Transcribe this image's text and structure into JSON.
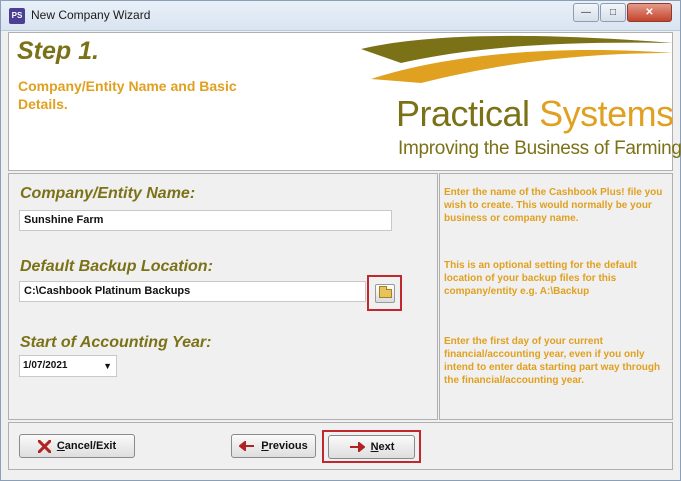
{
  "window": {
    "app_icon": "PS",
    "title": "New Company Wizard",
    "controls": [
      "minimize",
      "maximize",
      "close"
    ]
  },
  "header": {
    "step_title": "Step 1.",
    "step_subtitle": "Company/Entity Name and Basic Details.",
    "logo": {
      "name_part1": "Practical",
      "name_part2": "Systems",
      "tagline": "Improving the Business of Farming"
    }
  },
  "form": {
    "company_name": {
      "label": "Company/Entity Name:",
      "value": "Sunshine Farm"
    },
    "backup_location": {
      "label": "Default Backup Location:",
      "value": "C:\\Cashbook Platinum Backups",
      "browse_icon": "folder-icon"
    },
    "accounting_year": {
      "label": "Start of Accounting Year:",
      "value": "1/07/2021"
    }
  },
  "help": {
    "company_name": "Enter the name of the Cashbook Plus! file you wish to create. This would normally be your business or company name.",
    "backup_location": "This is an optional setting for the default location of your backup files for this company/entity e.g. A:\\Backup",
    "accounting_year": "Enter the first day of your current financial/accounting year, even if you only intend to enter data starting part way through the financial/accounting year."
  },
  "buttons": {
    "cancel": {
      "label_underlined": "C",
      "label_rest": "ancel/Exit"
    },
    "previous": {
      "label_underlined": "P",
      "label_rest": "revious"
    },
    "next": {
      "label_underlined": "N",
      "label_rest": "ext"
    }
  },
  "colors": {
    "olive": "#7b7218",
    "gold": "#e0a020",
    "highlight_red": "#c0282d"
  }
}
